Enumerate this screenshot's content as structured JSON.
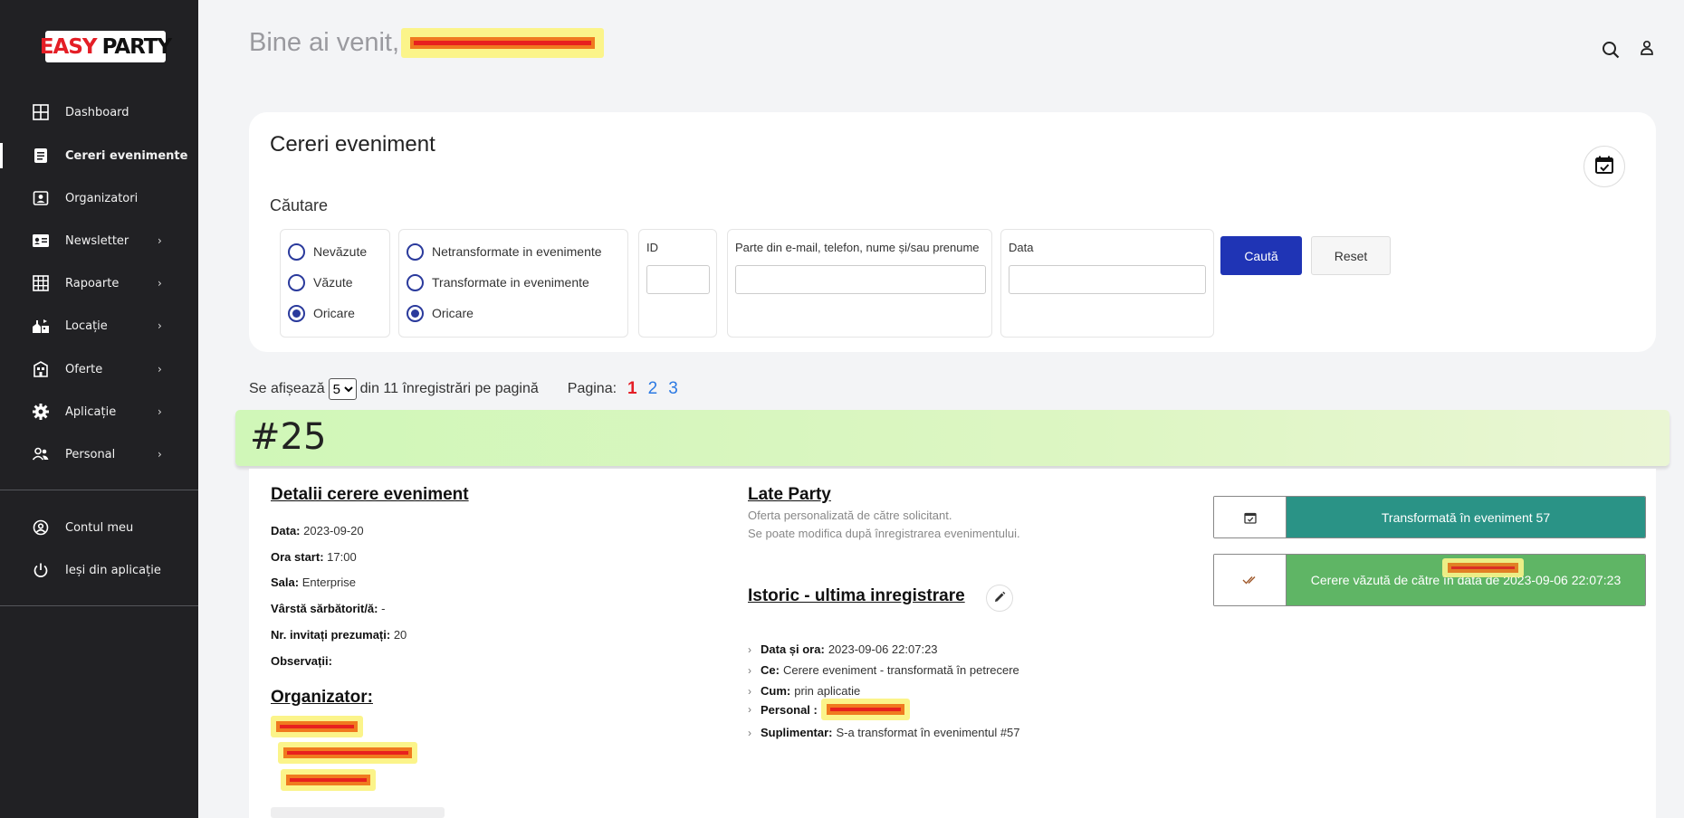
{
  "app": {
    "logo_part1": "EASY",
    "logo_part2": "PARTY",
    "welcome": "Bine ai venit,"
  },
  "sidebar": {
    "items": [
      {
        "label": "Dashboard",
        "icon": "dashboard-icon",
        "has_submenu": false
      },
      {
        "label": "Cereri evenimente",
        "icon": "document-icon",
        "has_submenu": false,
        "active": true
      },
      {
        "label": "Organizatori",
        "icon": "contact-icon",
        "has_submenu": false
      },
      {
        "label": "Newsletter",
        "icon": "id-card-icon",
        "has_submenu": true
      },
      {
        "label": "Rapoarte",
        "icon": "grid-icon",
        "has_submenu": true
      },
      {
        "label": "Locație",
        "icon": "location-icon",
        "has_submenu": true
      },
      {
        "label": "Oferte",
        "icon": "building-icon",
        "has_submenu": true
      },
      {
        "label": "Aplicație",
        "icon": "gear-icon",
        "has_submenu": true
      },
      {
        "label": "Personal",
        "icon": "people-icon",
        "has_submenu": true
      }
    ],
    "account": [
      {
        "label": "Contul meu",
        "icon": "user-circle-icon"
      },
      {
        "label": "Ieși din aplicație",
        "icon": "power-icon"
      }
    ],
    "chevron": "›"
  },
  "search_card": {
    "title": "Cereri eveniment",
    "search_label": "Căutare",
    "seen_filter": [
      "Nevăzute",
      "Văzute",
      "Oricare"
    ],
    "seen_selected": "Oricare",
    "transform_filter": [
      "Netransformate in evenimente",
      "Transformate in evenimente",
      "Oricare"
    ],
    "transform_selected": "Oricare",
    "id_label": "ID",
    "id_value": "",
    "query_label": "Parte din e-mail, telefon, nume și/sau prenume",
    "query_value": "",
    "date_label": "Data",
    "date_value": "",
    "search_button": "Caută",
    "reset_button": "Reset"
  },
  "pagination": {
    "show_prefix": "Se afișează",
    "per_page": "5",
    "show_suffix": "din 11 înregistrări pe pagină",
    "page_label": "Pagina:",
    "pages": [
      "1",
      "2",
      "3"
    ],
    "current_page": "1"
  },
  "record": {
    "number": "#25",
    "details_title": "Detalii cerere eveniment",
    "details": [
      {
        "key": "Data:",
        "value": "2023-09-20"
      },
      {
        "key": "Ora start:",
        "value": "17:00"
      },
      {
        "key": "Sala:",
        "value": "Enterprise"
      },
      {
        "key": "Vârstă sărbătorit/ă:",
        "value": "-"
      },
      {
        "key": "Nr. invitați prezumați:",
        "value": "20"
      },
      {
        "key": "Observații:",
        "value": ""
      }
    ],
    "organizer_title": "Organizator:",
    "offer_title": "Late Party",
    "offer_sub1": "Oferta personalizată de către solicitant.",
    "offer_sub2": "Se poate modifica după înregistrarea evenimentului.",
    "history_title": "Istoric - ultima inregistrare",
    "history": [
      {
        "key": "Data și ora:",
        "value": "2023-09-06 22:07:23"
      },
      {
        "key": "Ce:",
        "value": "Cerere eveniment - transformată în petrecere"
      },
      {
        "key": "Cum:",
        "value": "prin aplicatie"
      },
      {
        "key": "Personal :",
        "value": ""
      },
      {
        "key": "Suplimentar:",
        "value": "S-a transformat în evenimentul #57"
      }
    ],
    "status_transformed": "Transformată în eveniment 57",
    "status_seen": "Cerere văzută de către          în data de 2023-09-06 22:07:23",
    "colors": {
      "transformed": "#2a9386",
      "seen": "#5fb565"
    }
  }
}
